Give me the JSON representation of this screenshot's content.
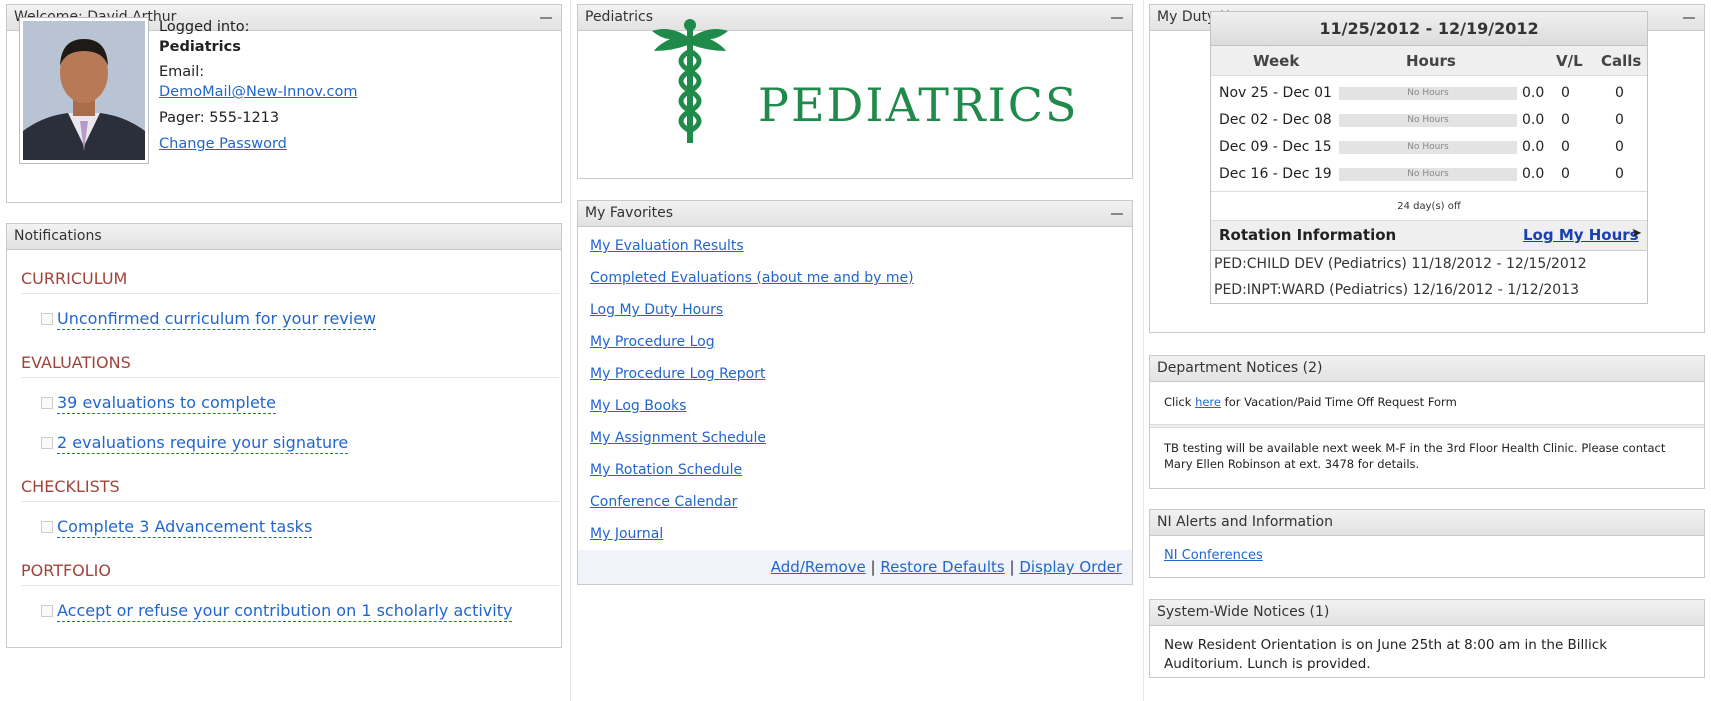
{
  "welcome": {
    "title": "Welcome: David Arthur",
    "logged_label": "Logged into:",
    "program": "Pediatrics",
    "email_label": "Email:",
    "email": "DemoMail@New-Innov.com",
    "pager": "Pager: 555-1213",
    "change_password": "Change Password"
  },
  "notifications": {
    "title": "Notifications",
    "sections": [
      {
        "heading": "CURRICULUM",
        "items": [
          "Unconfirmed curriculum for your review"
        ]
      },
      {
        "heading": "EVALUATIONS",
        "items": [
          "39 evaluations to complete",
          "2 evaluations require your signature"
        ]
      },
      {
        "heading": "CHECKLISTS",
        "items": [
          "Complete 3 Advancement tasks"
        ]
      },
      {
        "heading": "PORTFOLIO",
        "items": [
          "Accept or refuse your contribution on 1 scholarly activity"
        ]
      }
    ]
  },
  "pediatrics": {
    "title": "Pediatrics",
    "logo_text": "PEDIATRICS"
  },
  "favorites": {
    "title": "My Favorites",
    "links": [
      "My Evaluation Results",
      "Completed Evaluations (about me and by me)",
      "Log My Duty Hours",
      "My Procedure Log",
      "My Procedure Log Report",
      "My Log Books",
      "My Assignment Schedule",
      "My Rotation Schedule",
      "Conference Calendar",
      "My Journal"
    ],
    "add_remove": "Add/Remove",
    "sep": "|",
    "restore": "Restore Defaults",
    "display_order": "Display Order"
  },
  "duty": {
    "title": "My Duty Hours",
    "range": "11/25/2012 - 12/19/2012",
    "headers": {
      "week": "Week",
      "hours": "Hours",
      "vl": "V/L",
      "calls": "Calls"
    },
    "rows": [
      {
        "week": "Nov 25 - Dec 01",
        "bar": "No Hours",
        "hours": "0.0",
        "vl": "0",
        "calls": "0"
      },
      {
        "week": "Dec 02 - Dec 08",
        "bar": "No Hours",
        "hours": "0.0",
        "vl": "0",
        "calls": "0"
      },
      {
        "week": "Dec 09 - Dec 15",
        "bar": "No Hours",
        "hours": "0.0",
        "vl": "0",
        "calls": "0"
      },
      {
        "week": "Dec 16 - Dec 19",
        "bar": "No Hours",
        "hours": "0.0",
        "vl": "0",
        "calls": "0"
      }
    ],
    "days_off": "24 day(s) off",
    "rotation_label": "Rotation Information",
    "log_hours": "Log My Hours",
    "rotations": [
      "PED:CHILD DEV (Pediatrics) 11/18/2012 - 12/15/2012",
      "PED:INPT:WARD (Pediatrics) 12/16/2012 - 1/12/2013"
    ]
  },
  "dept": {
    "title": "Department Notices (2)",
    "click": "Click",
    "here": "here",
    "rest": "for Vacation/Paid Time Off Request Form",
    "tb": "TB testing will be available next week M-F in the 3rd Floor Health Clinic.  Please contact Mary Ellen Robinson at ext. 3478 for details."
  },
  "ni": {
    "title": "NI Alerts and Information",
    "link": "NI Conferences"
  },
  "system": {
    "title": "System-Wide Notices (1)",
    "text": "New Resident Orientation is on June 25th at 8:00 am in the Billick Auditorium.  Lunch is provided."
  },
  "colors": {
    "accent_link": "#2266cc",
    "section_heading": "#a0443a",
    "logo_green": "#1f8a4a"
  },
  "icons": [
    "minimize-icon",
    "caduceus-icon",
    "checkbox-icon",
    "arrow-right-icon"
  ]
}
